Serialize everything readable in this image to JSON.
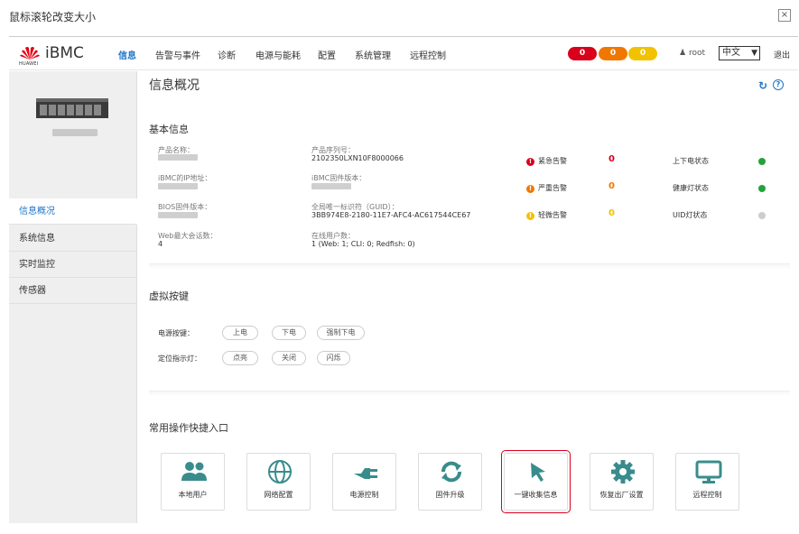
{
  "dialog": {
    "title": "鼠标滚轮改变大小"
  },
  "header": {
    "brand": "iBMC",
    "logo_text": "HUAWEI",
    "nav": [
      "信息",
      "告警与事件",
      "诊断",
      "电源与能耗",
      "配置",
      "系统管理",
      "远程控制"
    ],
    "alarm_counts": [
      "0",
      "0",
      "0"
    ],
    "user": "root",
    "language": "中文",
    "logout": "退出"
  },
  "sidebar": {
    "items": [
      "信息概况",
      "系统信息",
      "实时监控",
      "传感器"
    ]
  },
  "main": {
    "title": "信息概况",
    "basic_info_title": "基本信息",
    "fields": {
      "product_name_label": "产品名称：",
      "product_sn_label": "产品序列号：",
      "product_sn_value": "2102350LXN10F8000066",
      "ip_label": "iBMC的IP地址：",
      "fw_label": "iBMC固件版本：",
      "bios_label": "BIOS固件版本：",
      "guid_label": "全局唯一标识符（GUID）：",
      "guid_value": "3BB974E8-2180-11E7-AFC4-AC617544CE67",
      "web_max_label": "Web最大会话数：",
      "web_max_value": "4",
      "online_users_label": "在线用户数：",
      "online_users_value": "1 (Web: 1; CLI: 0; Redfish: 0)"
    },
    "alarms": [
      {
        "label": "紧急告警",
        "count": "0",
        "color": "#d9001b"
      },
      {
        "label": "严重告警",
        "count": "0",
        "color": "#f07800"
      },
      {
        "label": "轻微告警",
        "count": "0",
        "color": "#f2c200"
      }
    ],
    "statuses": [
      {
        "label": "上下电状态",
        "color": "#22a33a"
      },
      {
        "label": "健康灯状态",
        "color": "#22a33a"
      },
      {
        "label": "UID灯状态",
        "color": "#cccccc"
      }
    ],
    "virtual_keys_title": "虚拟按键",
    "power_key_label": "电源按键：",
    "power_buttons": [
      "上电",
      "下电",
      "强制下电"
    ],
    "locate_label": "定位指示灯：",
    "locate_buttons": [
      "点亮",
      "关闭",
      "闪烁"
    ],
    "shortcuts_title": "常用操作快捷入口",
    "shortcuts": [
      {
        "label": "本地用户",
        "icon": "users-icon"
      },
      {
        "label": "网络配置",
        "icon": "globe-icon"
      },
      {
        "label": "电源控制",
        "icon": "plug-icon"
      },
      {
        "label": "固件升级",
        "icon": "sync-icon"
      },
      {
        "label": "一键收集信息",
        "icon": "cursor-icon"
      },
      {
        "label": "恢复出厂设置",
        "icon": "gear-icon"
      },
      {
        "label": "远程控制",
        "icon": "monitor-icon"
      }
    ]
  }
}
